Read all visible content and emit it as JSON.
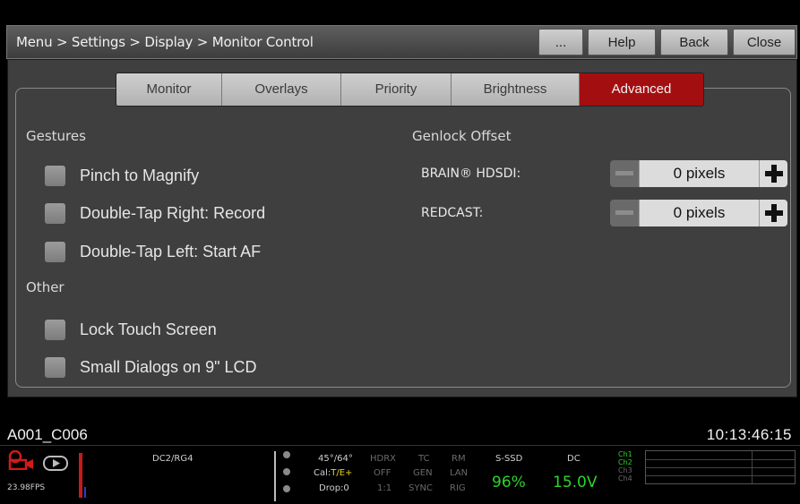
{
  "titlebar": {
    "breadcrumb": "Menu > Settings > Display > Monitor Control",
    "more_label": "...",
    "help_label": "Help",
    "back_label": "Back",
    "close_label": "Close"
  },
  "tabs": [
    {
      "label": "Monitor",
      "active": false
    },
    {
      "label": "Overlays",
      "active": false
    },
    {
      "label": "Priority",
      "active": false
    },
    {
      "label": "Brightness",
      "active": false
    },
    {
      "label": "Advanced",
      "active": true
    }
  ],
  "gestures": {
    "title": "Gestures",
    "items": [
      {
        "label": "Pinch to Magnify",
        "checked": false
      },
      {
        "label": "Double-Tap Right: Record",
        "checked": false
      },
      {
        "label": "Double-Tap Left: Start AF",
        "checked": false
      }
    ]
  },
  "other": {
    "title": "Other",
    "items": [
      {
        "label": "Lock Touch Screen",
        "checked": false
      },
      {
        "label": "Small Dialogs on 9\" LCD",
        "checked": false
      }
    ]
  },
  "genlock": {
    "title": "Genlock Offset",
    "rows": [
      {
        "label": "BRAIN® HDSDI:",
        "value": "0 pixels"
      },
      {
        "label": "REDCAST:",
        "value": "0 pixels"
      }
    ]
  },
  "status": {
    "clip_name": "A001_C006",
    "timecode": "10:13:46:15",
    "fps": "23.98FPS",
    "look": "DC2/RG4",
    "shutter": "45°/64°",
    "cal_prefix": "Cal:",
    "cal_value": "T/E+",
    "drop": "Drop:0",
    "hdrx": [
      "HDRX",
      "OFF",
      "1:1"
    ],
    "tc": [
      "TC",
      "GEN",
      "SYNC"
    ],
    "rm": [
      "RM",
      "LAN",
      "RIG"
    ],
    "media_label": "S-SSD",
    "media_value": "96%",
    "power_label": "DC",
    "power_value": "15.0V",
    "channels": [
      "Ch1",
      "Ch2",
      "Ch3",
      "Ch4"
    ]
  },
  "colors": {
    "accent_red": "#a30f10",
    "status_green": "#2ad62a"
  }
}
